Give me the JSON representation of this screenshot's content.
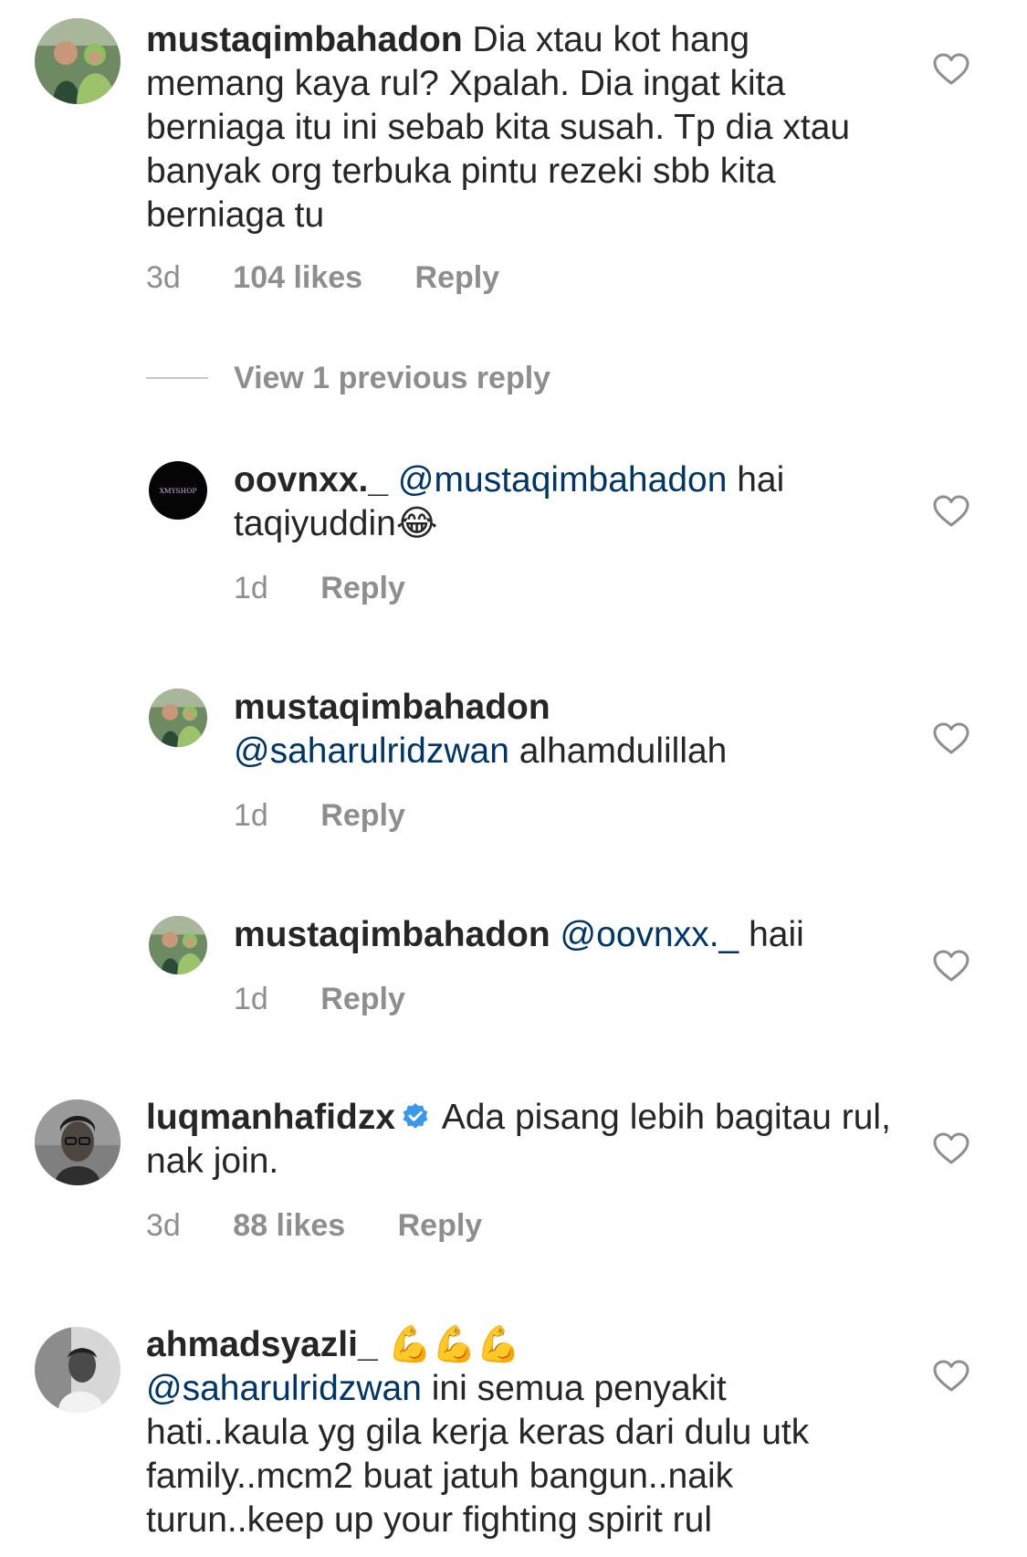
{
  "theme": {
    "text": "#262626",
    "muted": "#8e8e8e",
    "mention": "#003569",
    "verified": "#3897f0"
  },
  "comments": [
    {
      "username": "mustaqimbahadon",
      "text": "Dia xtau kot hang memang kaya rul? Xpalah. Dia ingat kita berniaga itu ini sebab kita susah. Tp dia xtau banyak org terbuka pintu rezeki sbb kita berniaga tu",
      "time": "3d",
      "likes": "104 likes",
      "reply": "Reply",
      "avatar": "couple-photo-avatar"
    },
    {
      "username": "luqmanhafidzx",
      "verified": true,
      "text": "Ada pisang lebih bagitau rul, nak join.",
      "time": "3d",
      "likes": "88 likes",
      "reply": "Reply",
      "avatar": "man-with-glasses-avatar"
    },
    {
      "username": "ahmadsyazli_",
      "emoji": "💪💪💪",
      "mention": "@saharulridzwan",
      "text": "ini semua penyakit hati..kaula yg gila kerja keras dari dulu utk family..mcm2 buat jatuh bangun..naik turun..keep up your fighting spirit rul",
      "avatar": "man-white-shirt-avatar"
    }
  ],
  "view_replies": "View 1 previous reply",
  "replies": [
    {
      "username": "oovnxx._",
      "mention": "@mustaqimbahadon",
      "text": "hai taqiyuddin",
      "emoji": "😂",
      "time": "1d",
      "reply": "Reply",
      "avatar_text": "XMYSHOP"
    },
    {
      "username": "mustaqimbahadon",
      "mention": "@saharulridzwan",
      "text": "alhamdulillah",
      "time": "1d",
      "reply": "Reply",
      "avatar": "couple-photo-avatar"
    },
    {
      "username": "mustaqimbahadon",
      "mention": "@oovnxx._",
      "text": "haii",
      "time": "1d",
      "reply": "Reply",
      "avatar": "couple-photo-avatar"
    }
  ]
}
